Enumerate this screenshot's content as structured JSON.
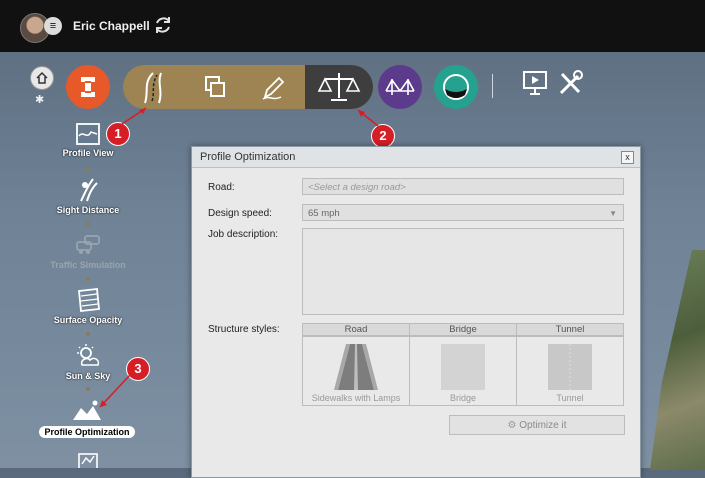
{
  "header": {
    "username": "Eric Chappell"
  },
  "toolbar": {
    "home_glyph": "⌂",
    "gear_glyph": "✱",
    "menu_glyph": "≡",
    "buttons": [
      {
        "icon": "infrastructure-logo-icon",
        "color": "#e8592a"
      },
      {
        "icon": "roads-icon",
        "color": "#9e8453"
      },
      {
        "icon": "layers-icon",
        "color": "#9e8453"
      },
      {
        "icon": "design-pen-icon",
        "color": "#9e8453"
      },
      {
        "icon": "analyze-scales-icon",
        "color": "#3e3e3e",
        "selected": true
      },
      {
        "icon": "bridge-icon",
        "color": "#5d3b8c"
      },
      {
        "icon": "water-icon",
        "color": "#24a28f"
      },
      {
        "icon": "presentation-icon"
      },
      {
        "icon": "tools-icon"
      }
    ]
  },
  "callouts": [
    "1",
    "2",
    "3"
  ],
  "sidebar": {
    "items": [
      {
        "label": "Profile View",
        "icon": "profile-view-icon"
      },
      {
        "label": "Sight Distance",
        "icon": "sight-distance-icon"
      },
      {
        "label": "Traffic Simulation",
        "icon": "traffic-simulation-icon",
        "disabled": true
      },
      {
        "label": "Surface Opacity",
        "icon": "surface-opacity-icon"
      },
      {
        "label": "Sun & Sky",
        "icon": "sun-sky-icon"
      },
      {
        "label": "Profile Optimization",
        "icon": "profile-optimization-icon",
        "active": true
      }
    ]
  },
  "dialog": {
    "title": "Profile Optimization",
    "close_label": "x",
    "road_label": "Road:",
    "road_placeholder": "<Select a design road>",
    "speed_label": "Design speed:",
    "speed_value": "65   mph",
    "job_label": "Job description:",
    "styles_label": "Structure styles:",
    "styles": {
      "headers": [
        "Road",
        "Bridge",
        "Tunnel"
      ],
      "captions": [
        "Sidewalks with Lamps",
        "Bridge",
        "Tunnel"
      ]
    },
    "optimize_label": "Optimize it"
  }
}
